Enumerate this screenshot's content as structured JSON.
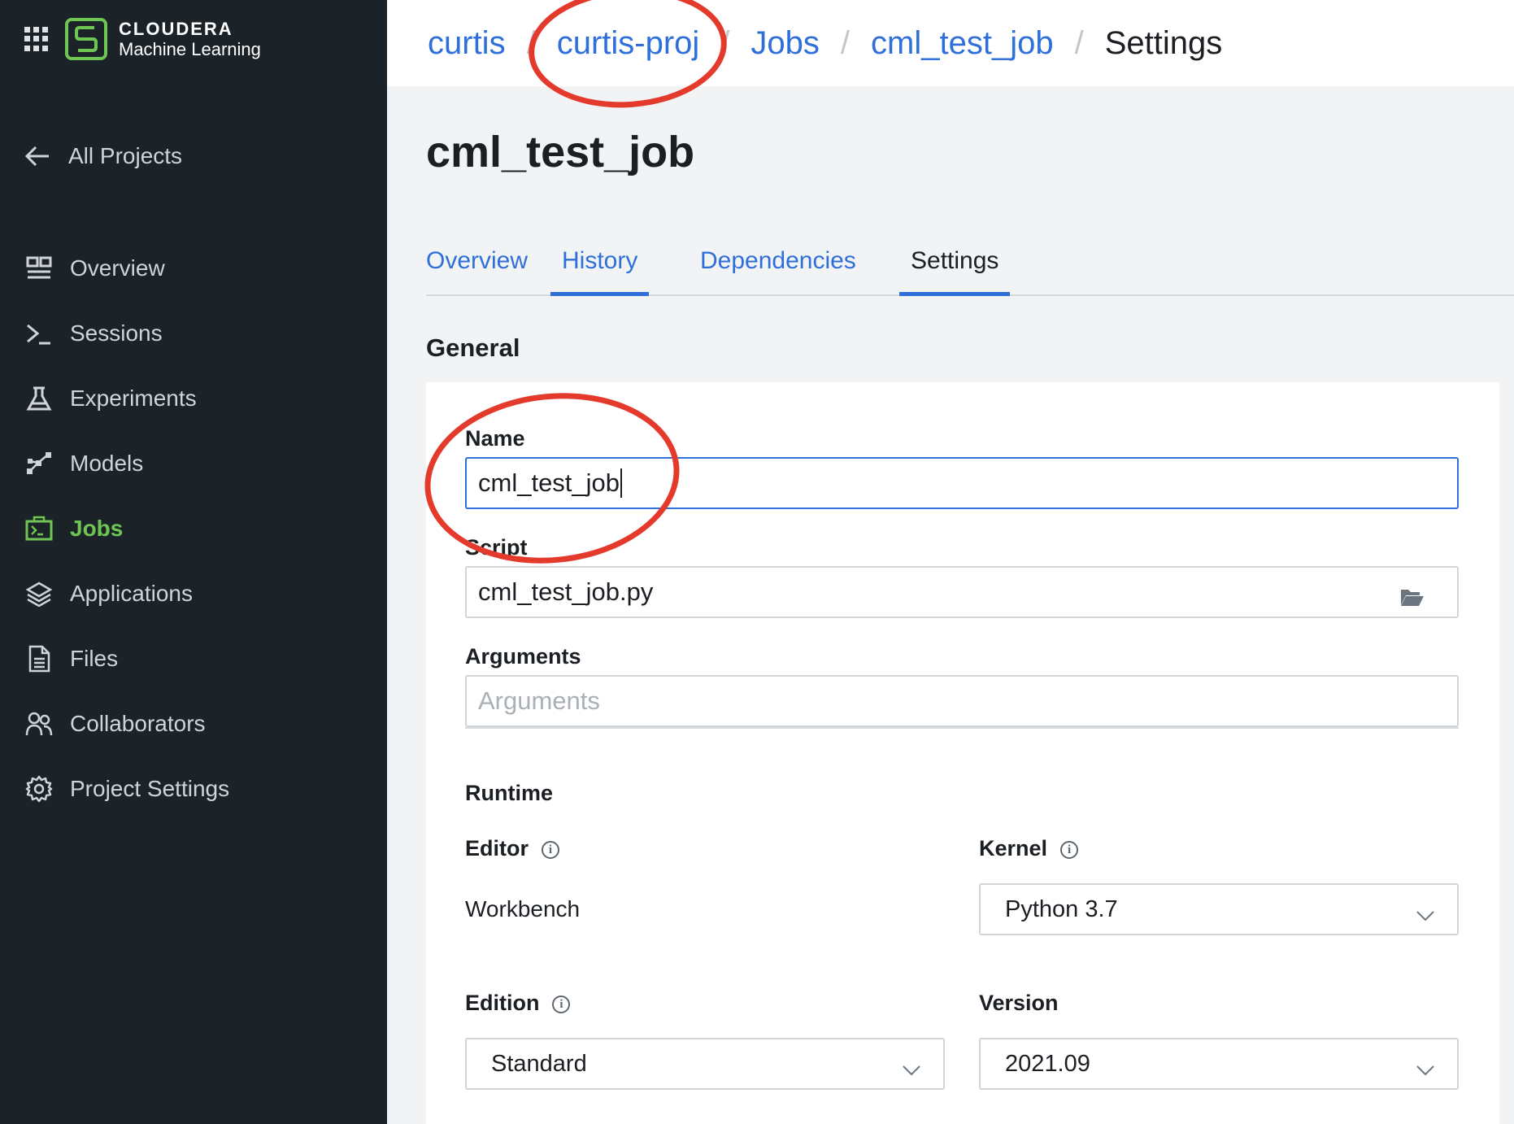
{
  "app": {
    "brand_top": "CLOUDERA",
    "brand_bottom": "Machine Learning"
  },
  "sidebar": {
    "back_label": "All Projects",
    "items": [
      {
        "label": "Overview",
        "icon": "overview-icon"
      },
      {
        "label": "Sessions",
        "icon": "terminal-icon"
      },
      {
        "label": "Experiments",
        "icon": "flask-icon"
      },
      {
        "label": "Models",
        "icon": "models-icon"
      },
      {
        "label": "Jobs",
        "icon": "jobs-icon",
        "active": true
      },
      {
        "label": "Applications",
        "icon": "layers-icon"
      },
      {
        "label": "Files",
        "icon": "file-icon"
      },
      {
        "label": "Collaborators",
        "icon": "users-icon"
      },
      {
        "label": "Project Settings",
        "icon": "gear-icon"
      }
    ]
  },
  "breadcrumb": {
    "items": [
      "curtis",
      "curtis-proj",
      "Jobs",
      "cml_test_job",
      "Settings"
    ],
    "separator": "/"
  },
  "page": {
    "title": "cml_test_job",
    "tabs": [
      "Overview",
      "History",
      "Dependencies",
      "Settings"
    ],
    "section_title": "General"
  },
  "form": {
    "name_label": "Name",
    "name_value": "cml_test_job",
    "script_label": "Script",
    "script_value": "cml_test_job.py",
    "arguments_label": "Arguments",
    "arguments_placeholder": "Arguments",
    "runtime_title": "Runtime",
    "editor_label": "Editor",
    "editor_value": "Workbench",
    "kernel_label": "Kernel",
    "kernel_value": "Python 3.7",
    "edition_label": "Edition",
    "edition_value": "Standard",
    "version_label": "Version",
    "version_value": "2021.09"
  },
  "colors": {
    "sidebar_bg": "#1b2329",
    "accent_green": "#6fc553",
    "link_blue": "#2e6fd9",
    "annotation_red": "#e33a2c"
  }
}
